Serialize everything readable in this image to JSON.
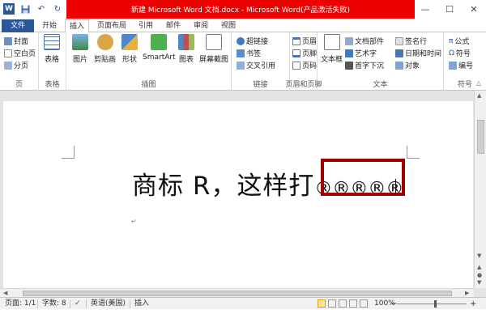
{
  "titlebar": {
    "title": "新建 Microsoft Word 文档.docx - Microsoft Word(产品激活失败)",
    "app_icon": "W",
    "undo_icon": "undo-icon",
    "redo_icon": "redo-icon",
    "minimize": "—",
    "maximize": "☐",
    "close": "✕"
  },
  "tabs": [
    "文件",
    "开始",
    "插入",
    "页面布局",
    "引用",
    "邮件",
    "审阅",
    "视图"
  ],
  "ribbon": {
    "pages_group": {
      "label": "页",
      "items": [
        "封面",
        "空白页",
        "分页"
      ]
    },
    "table_group": {
      "label": "表格",
      "button": "表格"
    },
    "illustrations_group": {
      "label": "插图",
      "buttons": [
        "图片",
        "剪贴画",
        "形状",
        "SmartArt",
        "图表",
        "屏幕截图"
      ]
    },
    "links_group": {
      "label": "链接",
      "items": [
        "超链接",
        "书签",
        "交叉引用"
      ]
    },
    "header_footer_group": {
      "label": "页眉和页脚",
      "items": [
        "页眉",
        "页脚",
        "页码"
      ]
    },
    "text_group": {
      "label": "文本",
      "big_button": "文本框",
      "col1": [
        "文档部件",
        "艺术字",
        "首字下沉"
      ],
      "col2": [
        "签名行",
        "日期和时间",
        "对象"
      ]
    },
    "symbols_group": {
      "label": "符号",
      "items": [
        "公式",
        "符号",
        "编号"
      ]
    }
  },
  "document": {
    "text_main": "商标 R，这样打",
    "text_symbols": "®®®®®",
    "return_mark": "↵"
  },
  "statusbar": {
    "page": "页面: 1/1",
    "words": "字数: 8",
    "language": "英语(美国)",
    "mode": "插入",
    "zoom": "100%",
    "zoom_minus": "−",
    "zoom_plus": "+"
  }
}
